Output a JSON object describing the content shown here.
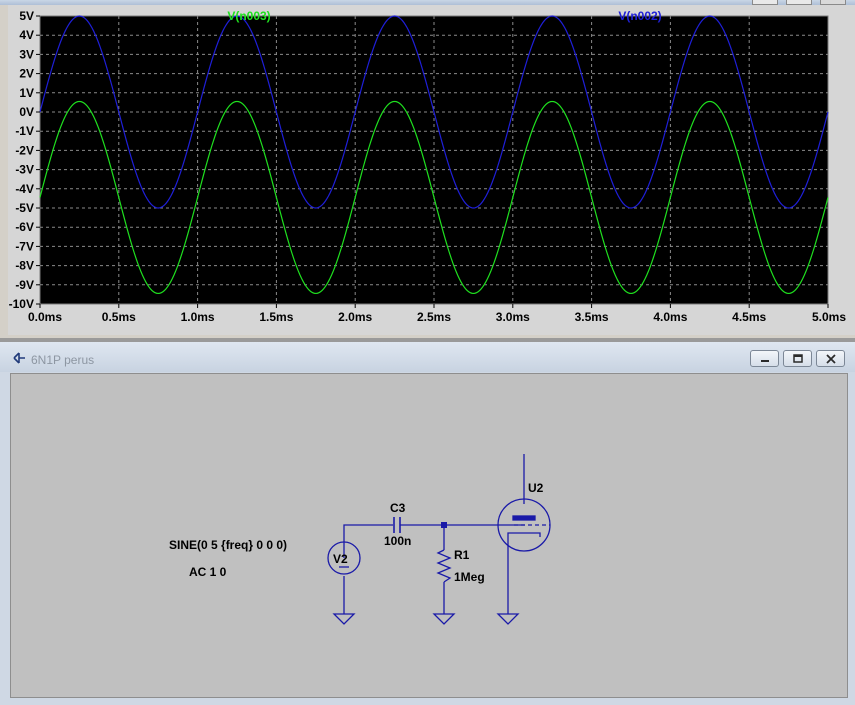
{
  "plot_window": {
    "trace_labels": [
      {
        "name": "V(n003)",
        "color": "#1fe01f"
      },
      {
        "name": "V(n002)",
        "color": "#1f1fd8"
      }
    ],
    "background_color": "#000000",
    "grid_color": "#8a8a8a"
  },
  "chart_data": {
    "type": "line",
    "title": "",
    "xlabel": "",
    "ylabel": "",
    "xlim": [
      0,
      5.0
    ],
    "ylim": [
      -10,
      5
    ],
    "grid": true,
    "x_ticks": [
      "0.0ms",
      "0.5ms",
      "1.0ms",
      "1.5ms",
      "2.0ms",
      "2.5ms",
      "3.0ms",
      "3.5ms",
      "4.0ms",
      "4.5ms",
      "5.0ms"
    ],
    "y_ticks": [
      "5V",
      "4V",
      "3V",
      "2V",
      "1V",
      "0V",
      "-1V",
      "-2V",
      "-3V",
      "-4V",
      "-5V",
      "-6V",
      "-7V",
      "-8V",
      "-9V",
      "-10V"
    ],
    "series": [
      {
        "name": "V(n003)",
        "color": "#1fe01f",
        "waveform": "sine",
        "offset_V": -4.45,
        "amplitude_V": 5,
        "frequency_kHz": 1,
        "start_x": 0.0,
        "start_y": -4.45,
        "peak_y": 0.55,
        "trough_y": -9.45
      },
      {
        "name": "V(n002)",
        "color": "#1f1fd8",
        "waveform": "sine",
        "offset_V": 0,
        "amplitude_V": 5,
        "frequency_kHz": 1,
        "start_x": 0.0,
        "start_y": 0,
        "peak_y": 5,
        "trough_y": -5
      }
    ]
  },
  "schematic_window": {
    "title": "6N1P perus",
    "controls": [
      "minimize",
      "restore",
      "close"
    ]
  },
  "schematic": {
    "source_directive": "SINE(0 5 {freq} 0 0 0)",
    "ac_directive": "AC 1 0",
    "components": {
      "v2": "V2",
      "c3": "C3",
      "c3_value": "100n",
      "r1": "R1",
      "r1_value": "1Meg",
      "u2": "U2"
    },
    "wire_color": "#1a1aa8"
  }
}
